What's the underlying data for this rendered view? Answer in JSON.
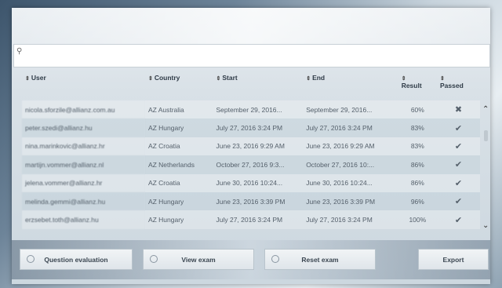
{
  "search": {
    "placeholder": ""
  },
  "table": {
    "columns": {
      "user": "User",
      "country": "Country",
      "start": "Start",
      "end": "End",
      "result": "Result",
      "passed": "Passed"
    },
    "sort_glyph": "⇕",
    "rows": [
      {
        "user": "nicola.sforzile@allianz.com.au",
        "country": "AZ Australia",
        "start": "September 29, 2016...",
        "end": "September 29, 2016...",
        "result": "60%",
        "passed": "✖"
      },
      {
        "user": "peter.szedi@allianz.hu",
        "country": "AZ Hungary",
        "start": "July 27, 2016 3:24 PM",
        "end": "July 27, 2016 3:24 PM",
        "result": "83%",
        "passed": "✔"
      },
      {
        "user": "nina.marinkovic@allianz.hr",
        "country": "AZ Croatia",
        "start": "June 23, 2016 9:29 AM",
        "end": "June 23, 2016 9:29 AM",
        "result": "83%",
        "passed": "✔"
      },
      {
        "user": "martijn.vommer@allianz.nl",
        "country": "AZ Netherlands",
        "start": "October 27, 2016 9:3...",
        "end": "October 27, 2016 10:...",
        "result": "86%",
        "passed": "✔"
      },
      {
        "user": "jelena.vommer@allianz.hr",
        "country": "AZ Croatia",
        "start": "June 30, 2016 10:24...",
        "end": "June 30, 2016 10:24...",
        "result": "86%",
        "passed": "✔"
      },
      {
        "user": "melinda.gemmi@allianz.hu",
        "country": "AZ Hungary",
        "start": "June 23, 2016 3:39 PM",
        "end": "June 23, 2016 3:39 PM",
        "result": "96%",
        "passed": "✔"
      },
      {
        "user": "erzsebet.toth@allianz.hu",
        "country": "AZ Hungary",
        "start": "July 27, 2016 3:24 PM",
        "end": "July 27, 2016 3:24 PM",
        "result": "100%",
        "passed": "✔"
      }
    ]
  },
  "scrollbar": {
    "up": "⌃",
    "down": "⌄"
  },
  "buttons": {
    "question_evaluation": "Question evaluation",
    "view_exam": "View exam",
    "reset_exam": "Reset exam",
    "export": "Export"
  }
}
